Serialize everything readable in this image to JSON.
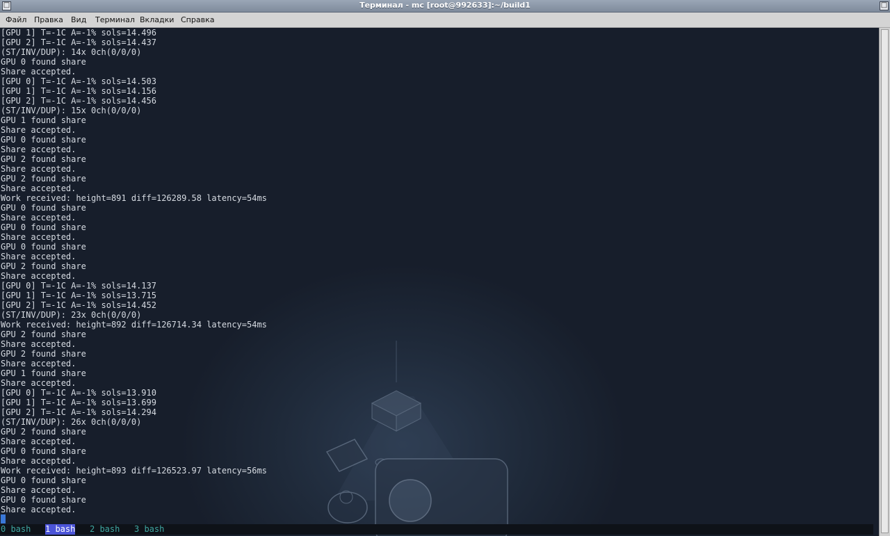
{
  "window": {
    "title": "Терминал - mc [root@992633]:~/build1",
    "left_button": "□",
    "right_button": "□"
  },
  "menu": [
    "Файл",
    "Правка",
    "Вид",
    "Терминал",
    "Вкладки",
    "Справка"
  ],
  "terminal": {
    "lines": [
      "[GPU 1] T=-1C A=-1% sols=14.496",
      "[GPU 2] T=-1C A=-1% sols=14.437",
      "(ST/INV/DUP): 14x 0ch(0/0/0)",
      "GPU 0 found share",
      "Share accepted.",
      "[GPU 0] T=-1C A=-1% sols=14.503",
      "[GPU 1] T=-1C A=-1% sols=14.156",
      "[GPU 2] T=-1C A=-1% sols=14.456",
      "(ST/INV/DUP): 15x 0ch(0/0/0)",
      "GPU 1 found share",
      "Share accepted.",
      "GPU 0 found share",
      "Share accepted.",
      "GPU 2 found share",
      "Share accepted.",
      "GPU 2 found share",
      "Share accepted.",
      "Work received: height=891 diff=126289.58 latency=54ms",
      "GPU 0 found share",
      "Share accepted.",
      "GPU 0 found share",
      "Share accepted.",
      "GPU 0 found share",
      "Share accepted.",
      "GPU 2 found share",
      "Share accepted.",
      "[GPU 0] T=-1C A=-1% sols=14.137",
      "[GPU 1] T=-1C A=-1% sols=13.715",
      "[GPU 2] T=-1C A=-1% sols=14.452",
      "(ST/INV/DUP): 23x 0ch(0/0/0)",
      "Work received: height=892 diff=126714.34 latency=54ms",
      "GPU 2 found share",
      "Share accepted.",
      "GPU 2 found share",
      "Share accepted.",
      "GPU 1 found share",
      "Share accepted.",
      "[GPU 0] T=-1C A=-1% sols=13.910",
      "[GPU 1] T=-1C A=-1% sols=13.699",
      "[GPU 2] T=-1C A=-1% sols=14.294",
      "(ST/INV/DUP): 26x 0ch(0/0/0)",
      "GPU 2 found share",
      "Share accepted.",
      "GPU 0 found share",
      "Share accepted.",
      "Work received: height=893 diff=126523.97 latency=56ms",
      "GPU 0 found share",
      "Share accepted.",
      "GPU 0 found share",
      "Share accepted."
    ]
  },
  "tabs": [
    {
      "label": "0 bash",
      "active": false
    },
    {
      "label": "1 bash",
      "active": true
    },
    {
      "label": "2 bash",
      "active": false
    },
    {
      "label": "3 bash",
      "active": false
    }
  ],
  "colors": {
    "text": "#d6dbe2",
    "tab_text": "#3fa7a2",
    "tab_active_bg": "#4b54d8",
    "cursor": "#3a78d8"
  }
}
